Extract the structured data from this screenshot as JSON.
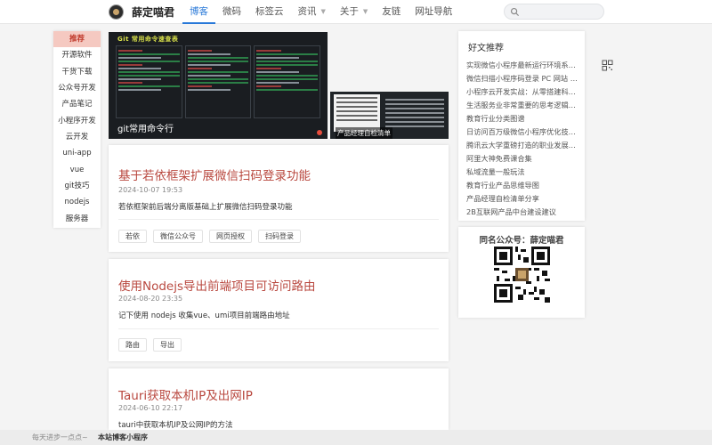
{
  "header": {
    "site_name": "薛定喵君",
    "nav": [
      {
        "label": "博客",
        "active": true
      },
      {
        "label": "微码"
      },
      {
        "label": "标签云"
      },
      {
        "label": "资讯",
        "has_caret": true
      },
      {
        "label": "关于",
        "has_caret": true
      },
      {
        "label": "友链"
      },
      {
        "label": "网址导航"
      }
    ],
    "search": {
      "placeholder": ""
    }
  },
  "sidebar": {
    "items": [
      "推荐",
      "开源软件",
      "干货下载",
      "公众号开发",
      "产品笔记",
      "小程序开发",
      "云开发",
      "uni-app",
      "vue",
      "git技巧",
      "nodejs",
      "服务器"
    ]
  },
  "carousel": {
    "main_caption": "git常用命令行",
    "main_image_heading": "Git 常用命令速查表",
    "thumb_caption": "产品经理自检清单",
    "dots": 2,
    "active_dot": 1
  },
  "articles": [
    {
      "title": "基于若依框架扩展微信扫码登录功能",
      "date": "2024-10-07 19:53",
      "summary": "若依框架前后端分离版基础上扩展微信扫码登录功能",
      "tags": [
        "若依",
        "微信公众号",
        "网页授权",
        "扫码登录"
      ]
    },
    {
      "title": "使用Nodejs导出前端项目可访问路由",
      "date": "2024-08-20 23:35",
      "summary": "记下使用 nodejs 收集vue、umi项目前端路由地址",
      "tags": [
        "路由",
        "导出"
      ]
    },
    {
      "title": "Tauri获取本机IP及出网IP",
      "date": "2024-06-10 22:17",
      "summary": "tauri中获取本机IP及公网IP的方法",
      "tags": []
    }
  ],
  "hot": {
    "title": "好文推荐",
    "items": [
      "实现微信小程序最新运行环境系列...",
      "微信扫描小程序码登录 PC 网站 D...",
      "小程序云开发实战：从零搭建科技...",
      "生活服务业非常重要的思考逻辑和...",
      "教育行业分类图谱",
      "日访问百万级微信小程序优化技巧...",
      "腾讯云大学重磅打造的职业发展学...",
      "阿里大神免费课合集",
      "私域流量一般玩法",
      "教育行业产品思维导图",
      "产品经理自检清单分享",
      "2B互联网产品中台建设建议"
    ]
  },
  "qr": {
    "title": "同名公众号：薛定喵君"
  },
  "footer": {
    "left": "每天进步一点点~",
    "right": "本站博客小程序"
  },
  "colors": {
    "accent": "#2878d8",
    "title_red": "#b9483f",
    "sidebar_active_bg": "#f5c9c1"
  },
  "icons": [
    "search-icon",
    "qrcode-icon",
    "caret-down-icon",
    "avatar-logo"
  ]
}
